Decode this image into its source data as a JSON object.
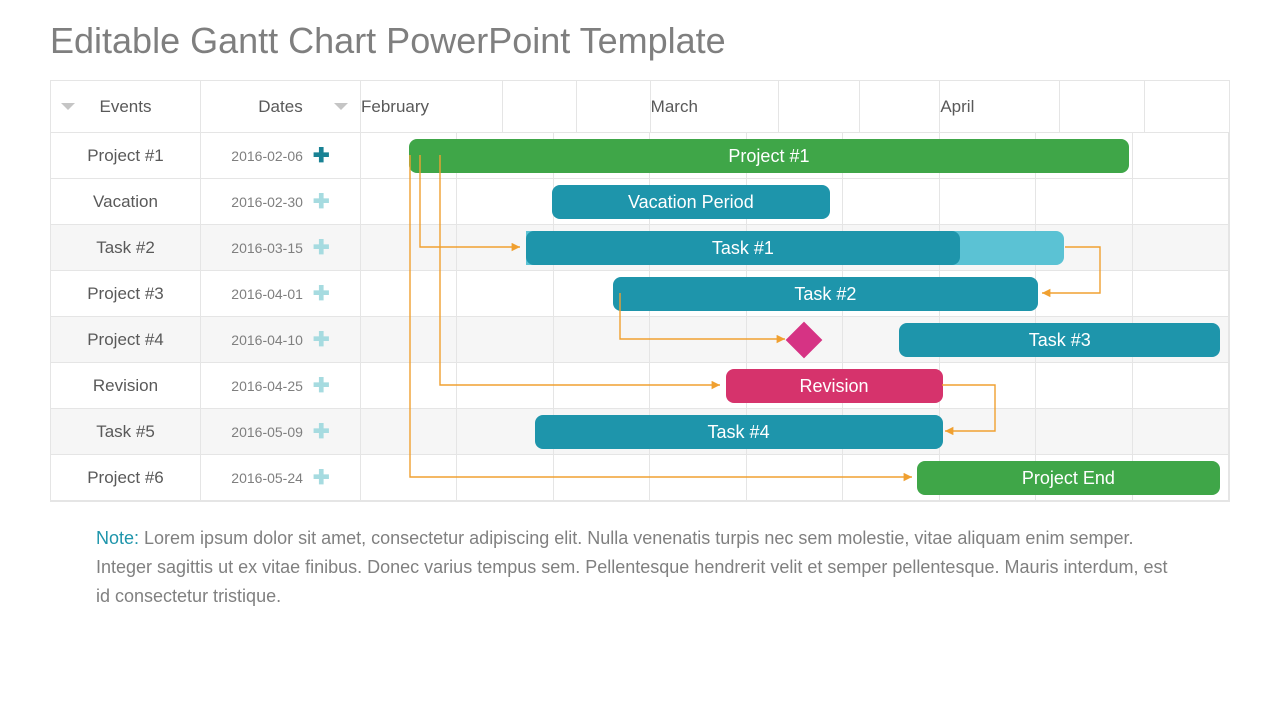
{
  "title": "Editable Gantt Chart PowerPoint Template",
  "headers": {
    "events": "Events",
    "dates": "Dates"
  },
  "months": [
    "February",
    "March",
    "April"
  ],
  "rows": [
    {
      "event": "Project #1",
      "date": "2016-02-06",
      "plus": "main"
    },
    {
      "event": "Vacation",
      "date": "2016-02-30",
      "plus": "faded"
    },
    {
      "event": "Task #2",
      "date": "2016-03-15",
      "plus": "faded"
    },
    {
      "event": "Project #3",
      "date": "2016-04-01",
      "plus": "faded"
    },
    {
      "event": "Project #4",
      "date": "2016-04-10",
      "plus": "faded"
    },
    {
      "event": "Revision",
      "date": "2016-04-25",
      "plus": "faded"
    },
    {
      "event": "Task #5",
      "date": "2016-05-09",
      "plus": "faded"
    },
    {
      "event": "Project #6",
      "date": "2016-05-24",
      "plus": "faded"
    }
  ],
  "note_label": "Note:",
  "note_text": " Lorem ipsum dolor sit amet, consectetur adipiscing elit. Nulla venenatis turpis nec sem molestie, vitae aliquam enim semper. Integer sagittis ut ex vitae finibus. Donec varius tempus sem. Pellentesque hendrerit velit et semper pellentesque. Mauris interdum, est id consectetur tristique.",
  "chart_data": {
    "type": "gantt",
    "time_axis": {
      "months": [
        "February",
        "March",
        "April"
      ],
      "subdivisions_per_month": 3,
      "total_cells": 9
    },
    "tasks": [
      {
        "row": 0,
        "label": "Project #1",
        "color": "green",
        "start_cell": 0.5,
        "end_cell": 8.0
      },
      {
        "row": 1,
        "label": "Vacation Period",
        "color": "teal",
        "start_cell": 2.0,
        "end_cell": 4.9
      },
      {
        "row": 2,
        "label": "Task #1",
        "color": "teal",
        "start_cell": 1.7,
        "end_cell": 6.2,
        "progress_end_cell": 7.3
      },
      {
        "row": 3,
        "label": "Task #2",
        "color": "teal",
        "start_cell": 2.6,
        "end_cell": 7.0
      },
      {
        "row": 4,
        "label": "milestone",
        "color": "magenta",
        "type": "milestone",
        "at_cell": 4.6
      },
      {
        "row": 4,
        "label": "Task #3",
        "color": "teal",
        "start_cell": 5.6,
        "end_cell": 8.9
      },
      {
        "row": 5,
        "label": "Revision",
        "color": "pink",
        "start_cell": 3.8,
        "end_cell": 6.0
      },
      {
        "row": 6,
        "label": "Task #4",
        "color": "teal",
        "start_cell": 1.8,
        "end_cell": 6.0
      },
      {
        "row": 7,
        "label": "Project End",
        "color": "green",
        "start_cell": 5.8,
        "end_cell": 8.9
      }
    ],
    "connectors": [
      {
        "from_row": 0,
        "to_row": 2,
        "style": "start-to-start"
      },
      {
        "from_row": 2,
        "to_row": 3,
        "style": "finish-to-finish"
      },
      {
        "from_row": 3,
        "to_row": 4,
        "style": "start-to-milestone"
      },
      {
        "from_row": 2,
        "to_row": 5,
        "style": "start-to-start"
      },
      {
        "from_row": 5,
        "to_row": 6,
        "style": "finish-to-finish"
      },
      {
        "from_row": 0,
        "to_row": 7,
        "style": "start-to-start"
      }
    ]
  }
}
